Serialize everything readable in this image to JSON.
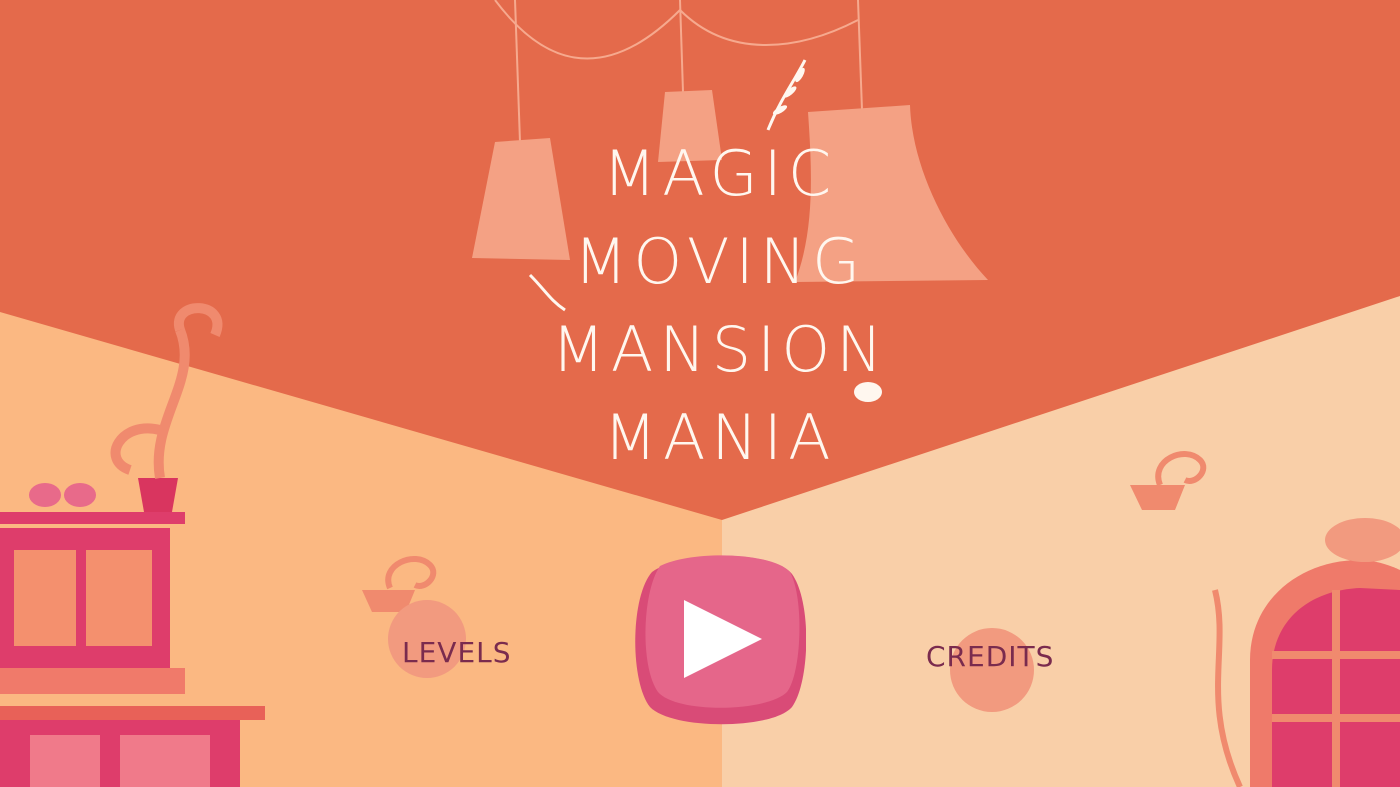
{
  "game": {
    "title_lines": [
      "MAGIC",
      "MOVING",
      "MANSION",
      "MANIA"
    ]
  },
  "menu": {
    "levels_label": "LEVELS",
    "credits_label": "CREDITS",
    "play_icon": "play-triangle-icon"
  },
  "colors": {
    "ceiling": "#e46a4b",
    "left_wall": "#fbb882",
    "right_wall": "#f9cfa8",
    "lamp": "#f4a184",
    "play_button": "#e5668a",
    "label_text": "#7a2b4e",
    "furniture": "#de3d6b"
  }
}
